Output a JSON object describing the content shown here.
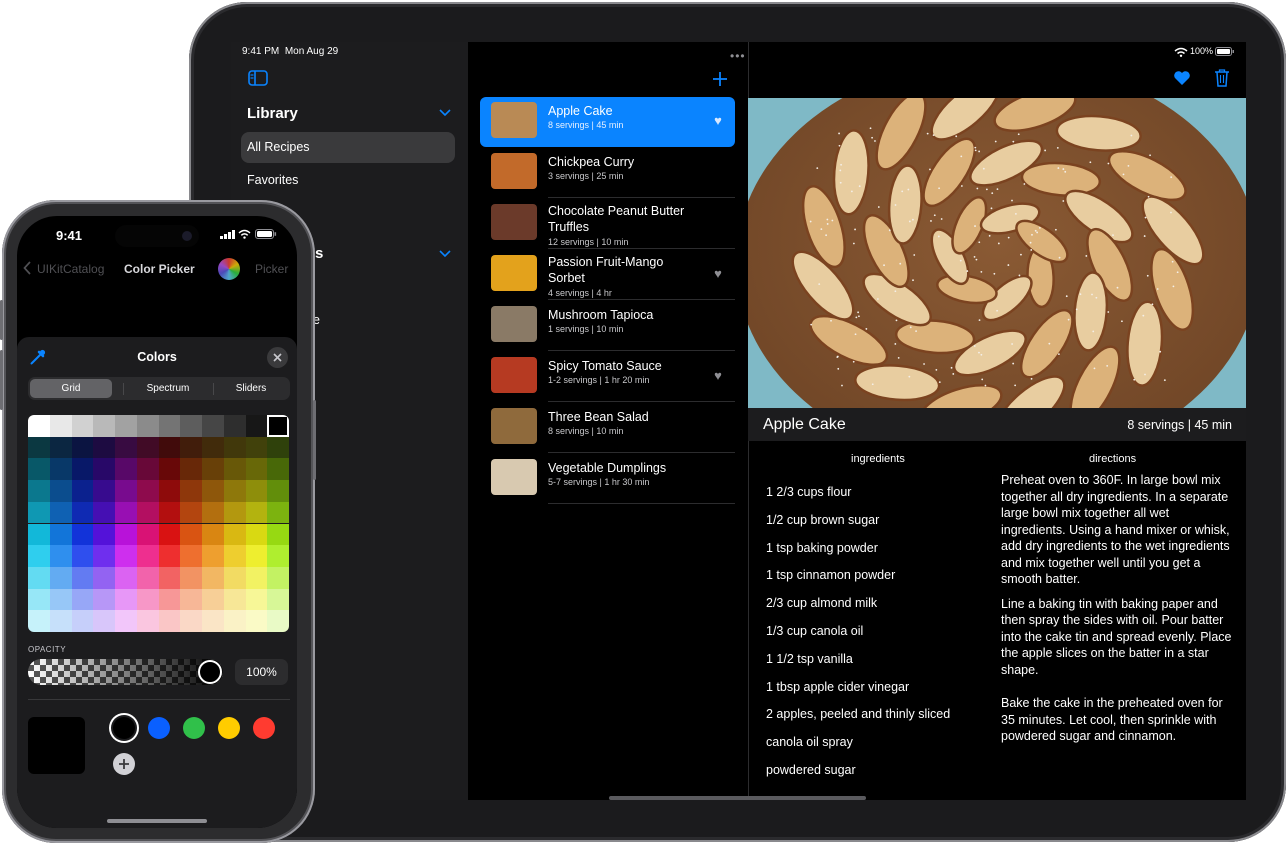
{
  "ipad": {
    "status": {
      "time": "9:41 PM",
      "date": "Mon Aug 29",
      "battery": "100%"
    },
    "sidebar": {
      "library_title": "Library",
      "items": [
        "All Recipes",
        "Favorites"
      ],
      "partial_section_letter": "s",
      "partial_item_letter": "e"
    },
    "recipes": [
      {
        "name": "Apple Cake",
        "meta": "8 servings | 45 min",
        "favorite": true,
        "selected": true,
        "thumb": "#b98a55"
      },
      {
        "name": "Chickpea Curry",
        "meta": "3 servings | 25 min",
        "favorite": false,
        "selected": false,
        "thumb": "#c26a2a"
      },
      {
        "name": "Chocolate Peanut Butter Truffles",
        "meta": "12 servings | 10 min",
        "favorite": false,
        "selected": false,
        "thumb": "#6b3a2a"
      },
      {
        "name": "Passion Fruit-Mango Sorbet",
        "meta": "4 servings | 4 hr",
        "favorite": true,
        "selected": false,
        "thumb": "#e3a21c"
      },
      {
        "name": "Mushroom Tapioca",
        "meta": "1 servings | 10 min",
        "favorite": false,
        "selected": false,
        "thumb": "#8a7a66"
      },
      {
        "name": "Spicy Tomato Sauce",
        "meta": "1-2 servings | 1 hr 20 min",
        "favorite": true,
        "selected": false,
        "thumb": "#b63a22"
      },
      {
        "name": "Three Bean Salad",
        "meta": "8 servings | 10 min",
        "favorite": false,
        "selected": false,
        "thumb": "#8f6a3c"
      },
      {
        "name": "Vegetable Dumplings",
        "meta": "5-7 servings | 1 hr 30 min",
        "favorite": false,
        "selected": false,
        "thumb": "#d8c9b0"
      }
    ],
    "detail": {
      "title": "Apple Cake",
      "meta": "8 servings | 45 min",
      "ingredients_header": "ingredients",
      "directions_header": "directions",
      "ingredients": [
        "1 2/3 cups flour",
        "1/2 cup brown sugar",
        "1 tsp baking powder",
        "1 tsp cinnamon powder",
        "2/3 cup almond milk",
        "1/3 cup canola oil",
        "1 1/2 tsp vanilla",
        "1 tbsp apple cider vinegar",
        "2 apples, peeled and thinly sliced",
        "canola oil spray",
        "powdered sugar"
      ],
      "directions": [
        "Preheat oven to 360F. In large bowl mix together all dry ingredients. In a separate large bowl mix together all wet ingredients. Using a hand mixer or whisk, add dry ingredients to the wet ingredients and mix together well until you get a smooth batter.",
        "Line a baking tin with baking paper and then spray the sides with oil. Pour batter into the cake tin and spread evenly. Place the apple slices on the batter in a star shape.",
        "Bake the cake in the preheated oven for 35 minutes. Let cool, then sprinkle with powdered sugar and cinnamon."
      ]
    },
    "colors": {
      "accent": "#0a84ff",
      "sidebar_bg": "#1c1c1e"
    }
  },
  "iphone": {
    "status_time": "9:41",
    "nav": {
      "back_label": "UIKitCatalog",
      "title": "Color Picker",
      "right_label": "Picker"
    },
    "picker": {
      "title": "Colors",
      "segments": [
        "Grid",
        "Spectrum",
        "Sliders"
      ],
      "selected_segment": "Grid",
      "opacity_label": "OPACITY",
      "opacity_value": "100%",
      "selected_color": "#000000",
      "swatches": [
        "#000000",
        "#0a60ff",
        "#30c04a",
        "#ffcc00",
        "#ff3b30"
      ]
    }
  }
}
